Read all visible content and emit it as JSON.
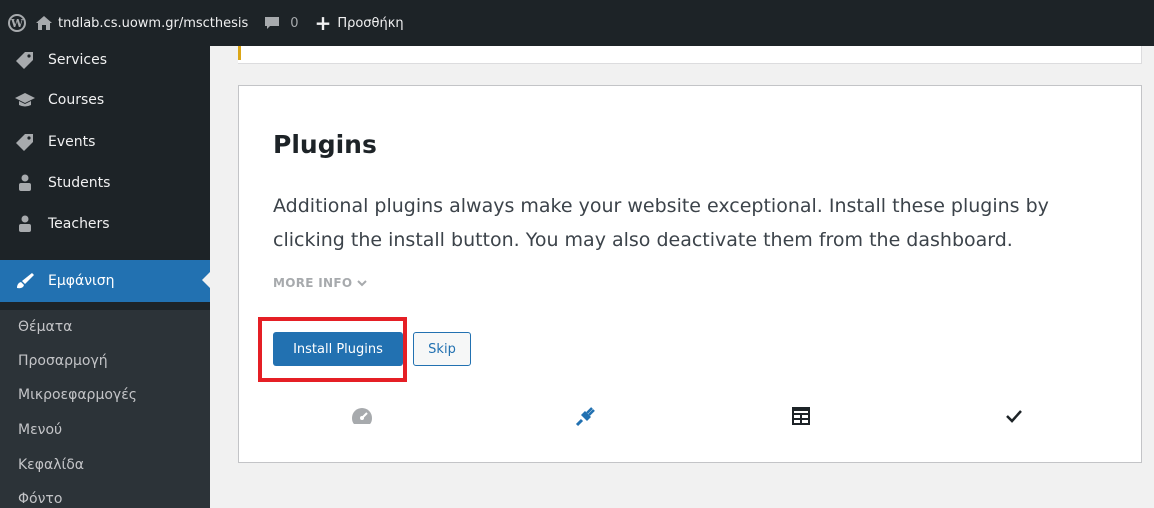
{
  "adminbar": {
    "site_name": "tndlab.cs.uowm.gr/mscthesis",
    "comments_count": "0",
    "new_label": "Προσθήκη"
  },
  "sidebar": {
    "items": [
      {
        "label": "Services",
        "icon": "tag-icon"
      },
      {
        "label": "Courses",
        "icon": "graduation-cap-icon"
      },
      {
        "label": "Events",
        "icon": "tag-icon"
      },
      {
        "label": "Students",
        "icon": "groups-icon"
      },
      {
        "label": "Teachers",
        "icon": "groups-icon"
      },
      {
        "label": "Εμφάνιση",
        "icon": "paintbrush-icon",
        "current": true
      }
    ],
    "submenu": [
      "Θέματα",
      "Προσαρμογή",
      "Μικροεφαρμογές",
      "Μενού",
      "Κεφαλίδα",
      "Φόντο"
    ]
  },
  "card": {
    "title": "Plugins",
    "description": "Additional plugins always make your website exceptional. Install these plugins by clicking the install button. You may also deactivate them from the dashboard.",
    "more_info": "MORE INFO",
    "install_label": "Install Plugins",
    "skip_label": "Skip",
    "steps": [
      "dashboard-icon",
      "plugin-icon",
      "layout-icon",
      "checkmark-icon"
    ]
  },
  "colors": {
    "admin_bg": "#1d2327",
    "accent": "#2271b1",
    "highlight": "#e51f25"
  }
}
